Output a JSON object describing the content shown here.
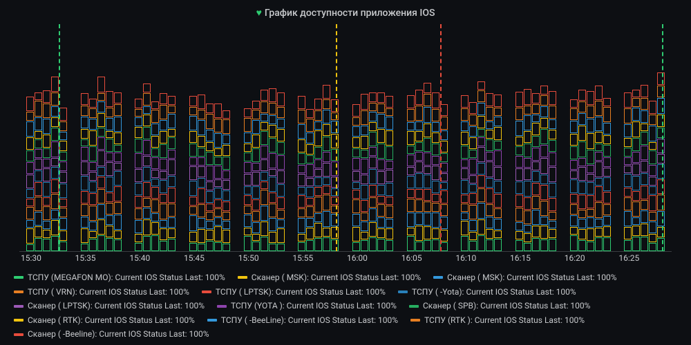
{
  "title": "График доступности приложения IOS",
  "chart_data": {
    "type": "bar",
    "stacked": true,
    "ylabel": "",
    "xlabel": "",
    "ylim": [
      0,
      1300
    ],
    "x_ticks": [
      "15:30",
      "15:35",
      "15:40",
      "15:45",
      "15:50",
      "15:55",
      "16:00",
      "16:05",
      "16:10",
      "16:15",
      "16:20",
      "16:25"
    ],
    "series": [
      {
        "name": "ТСПУ (MEGAFON MO): Current IOS Status",
        "last": "100%",
        "color": "#2ecc71",
        "height": 100
      },
      {
        "name": "Сканер (         MSK): Current IOS Status",
        "last": "100%",
        "color": "#f1c40f",
        "height": 100
      },
      {
        "name": "Сканер (       MSK): Current IOS Status",
        "last": "100%",
        "color": "#3498db",
        "height": 100
      },
      {
        "name": "ТСПУ (         VRN): Current IOS Status",
        "last": "100%",
        "color": "#e67e22",
        "height": 100
      },
      {
        "name": "ТСПУ (            LPTSK): Current IOS Status",
        "last": "100%",
        "color": "#e74c3c",
        "height": 100
      },
      {
        "name": "ТСПУ (        -Yota): Current IOS Status",
        "last": "100%",
        "color": "#2980b9",
        "height": 100
      },
      {
        "name": "Сканер (        LPTSK): Current IOS Status",
        "last": "100%",
        "color": "#9b59b6",
        "height": 100
      },
      {
        "name": "ТСПУ (YOTA         ): Current IOS Status",
        "last": "100%",
        "color": "#8e44ad",
        "height": 100
      },
      {
        "name": "Сканер (        SPB): Current IOS Status",
        "last": "100%",
        "color": "#27ae60",
        "height": 100
      },
      {
        "name": "Сканер (      RTK): Current IOS Status",
        "last": "100%",
        "color": "#f1c40f",
        "height": 100
      },
      {
        "name": "ТСПУ (    -BeeLine): Current IOS Status",
        "last": "100%",
        "color": "#3498db",
        "height": 100
      },
      {
        "name": "ТСПУ (RTK         ): Current IOS Status",
        "last": "100%",
        "color": "#e67e22",
        "height": 100
      },
      {
        "name": "Сканер (      -Beeline): Current IOS Status",
        "last": "100%",
        "color": "#e74c3c",
        "height": 100
      }
    ],
    "annotations": [
      {
        "x_pct": 6.0,
        "color": "#2ecc71"
      },
      {
        "x_pct": 48.5,
        "color": "#f1c40f"
      },
      {
        "x_pct": 64.5,
        "color": "#e74c3c"
      },
      {
        "x_pct": 98.5,
        "color": "#2ecc71"
      }
    ]
  },
  "legend_rows": [
    [
      0,
      1
    ],
    [
      2,
      3
    ],
    [
      4,
      5
    ],
    [
      6,
      7
    ],
    [
      8,
      9,
      10
    ],
    [
      11,
      12
    ]
  ]
}
